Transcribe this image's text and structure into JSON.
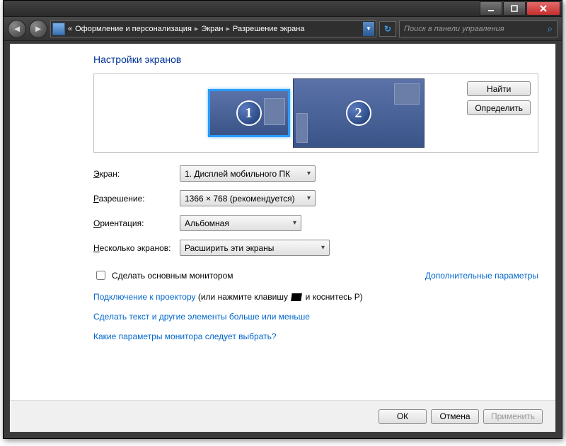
{
  "breadcrumb": {
    "back_prefix": "«",
    "parts": [
      "Оформление и персонализация",
      "Экран",
      "Разрешение экрана"
    ]
  },
  "search": {
    "placeholder": "Поиск в панели управления"
  },
  "page_title": "Настройки экранов",
  "side_buttons": {
    "find": "Найти",
    "identify": "Определить"
  },
  "monitors": {
    "m1": "1",
    "m2": "2"
  },
  "form": {
    "screen_label": "Экран:",
    "screen_value": "1. Дисплей мобильного ПК",
    "resolution_label": "Разрешение:",
    "resolution_value": "1366 × 768 (рекомендуется)",
    "orientation_label": "Ориентация:",
    "orientation_value": "Альбомная",
    "multi_label": "Несколько экранов:",
    "multi_value": "Расширить эти экраны"
  },
  "make_main": "Сделать основным монитором",
  "advanced": "Дополнительные параметры",
  "projector": {
    "link": "Подключение к проектору",
    "suffix_pre": " (или нажмите клавишу ",
    "suffix_post": " и коснитесь P)"
  },
  "textsize": "Сделать текст и другие элементы больше или меньше",
  "which": "Какие параметры монитора следует выбрать?",
  "footer": {
    "ok": "ОК",
    "cancel": "Отмена",
    "apply": "Применить"
  }
}
